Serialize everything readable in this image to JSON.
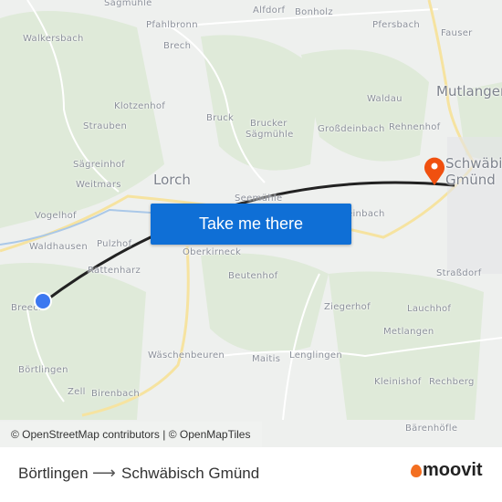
{
  "map": {
    "labels": [
      {
        "text": "Sägmühle",
        "big": false
      },
      {
        "text": "Pfahlbronn",
        "big": false
      },
      {
        "text": "Alfdorf",
        "big": false
      },
      {
        "text": "Bonholz",
        "big": false
      },
      {
        "text": "Pfersbach",
        "big": false
      },
      {
        "text": "Fauser",
        "big": false
      },
      {
        "text": "Walkersbach",
        "big": false
      },
      {
        "text": "Brech",
        "big": false
      },
      {
        "text": "Mutlangen",
        "big": true
      },
      {
        "text": "Waldau",
        "big": false
      },
      {
        "text": "Klotzenhof",
        "big": false
      },
      {
        "text": "Bruck",
        "big": false
      },
      {
        "text": "Brucker",
        "big": false
      },
      {
        "text": "Sägmühle",
        "big": false
      },
      {
        "text": "Großdeinbach",
        "big": false
      },
      {
        "text": "Rehnenhof",
        "big": false
      },
      {
        "text": "Strauben",
        "big": false
      },
      {
        "text": "Sägreinhof",
        "big": false
      },
      {
        "text": "Lorch",
        "big": true
      },
      {
        "text": "Schwäbisch",
        "big": true
      },
      {
        "text": "Gmünd",
        "big": true
      },
      {
        "text": "Weitmars",
        "big": false
      },
      {
        "text": "Seemühle",
        "big": false
      },
      {
        "text": "Vogelhof",
        "big": false
      },
      {
        "text": "Deinbach",
        "big": false
      },
      {
        "text": "Waldhausen",
        "big": false
      },
      {
        "text": "Pulzhof",
        "big": false
      },
      {
        "text": "Oberkirneck",
        "big": false
      },
      {
        "text": "Rattenharz",
        "big": false
      },
      {
        "text": "Beutenhof",
        "big": false
      },
      {
        "text": "Straßdorf",
        "big": false
      },
      {
        "text": "Breech",
        "big": false
      },
      {
        "text": "Ziegerhof",
        "big": false
      },
      {
        "text": "Lauchhof",
        "big": false
      },
      {
        "text": "Metlangen",
        "big": false
      },
      {
        "text": "Wäschenbeuren",
        "big": false
      },
      {
        "text": "Maitis",
        "big": false
      },
      {
        "text": "Lenglingen",
        "big": false
      },
      {
        "text": "Börtlingen",
        "big": false
      },
      {
        "text": "Kleinishof",
        "big": false
      },
      {
        "text": "Rechberg",
        "big": false
      },
      {
        "text": "Zell",
        "big": false
      },
      {
        "text": "Birenbach",
        "big": false
      },
      {
        "text": "Bärenhöfle",
        "big": false
      }
    ],
    "origin_marker_color": "#3c78f0",
    "destination_marker_color": "#f0500f",
    "route_color": "#222222"
  },
  "cta": {
    "label": "Take me there"
  },
  "attribution": "© OpenStreetMap contributors | © OpenMapTiles",
  "footer": {
    "from": "Börtlingen",
    "arrow": "⟶",
    "to": "Schwäbisch Gmünd",
    "logo": "moovit"
  }
}
